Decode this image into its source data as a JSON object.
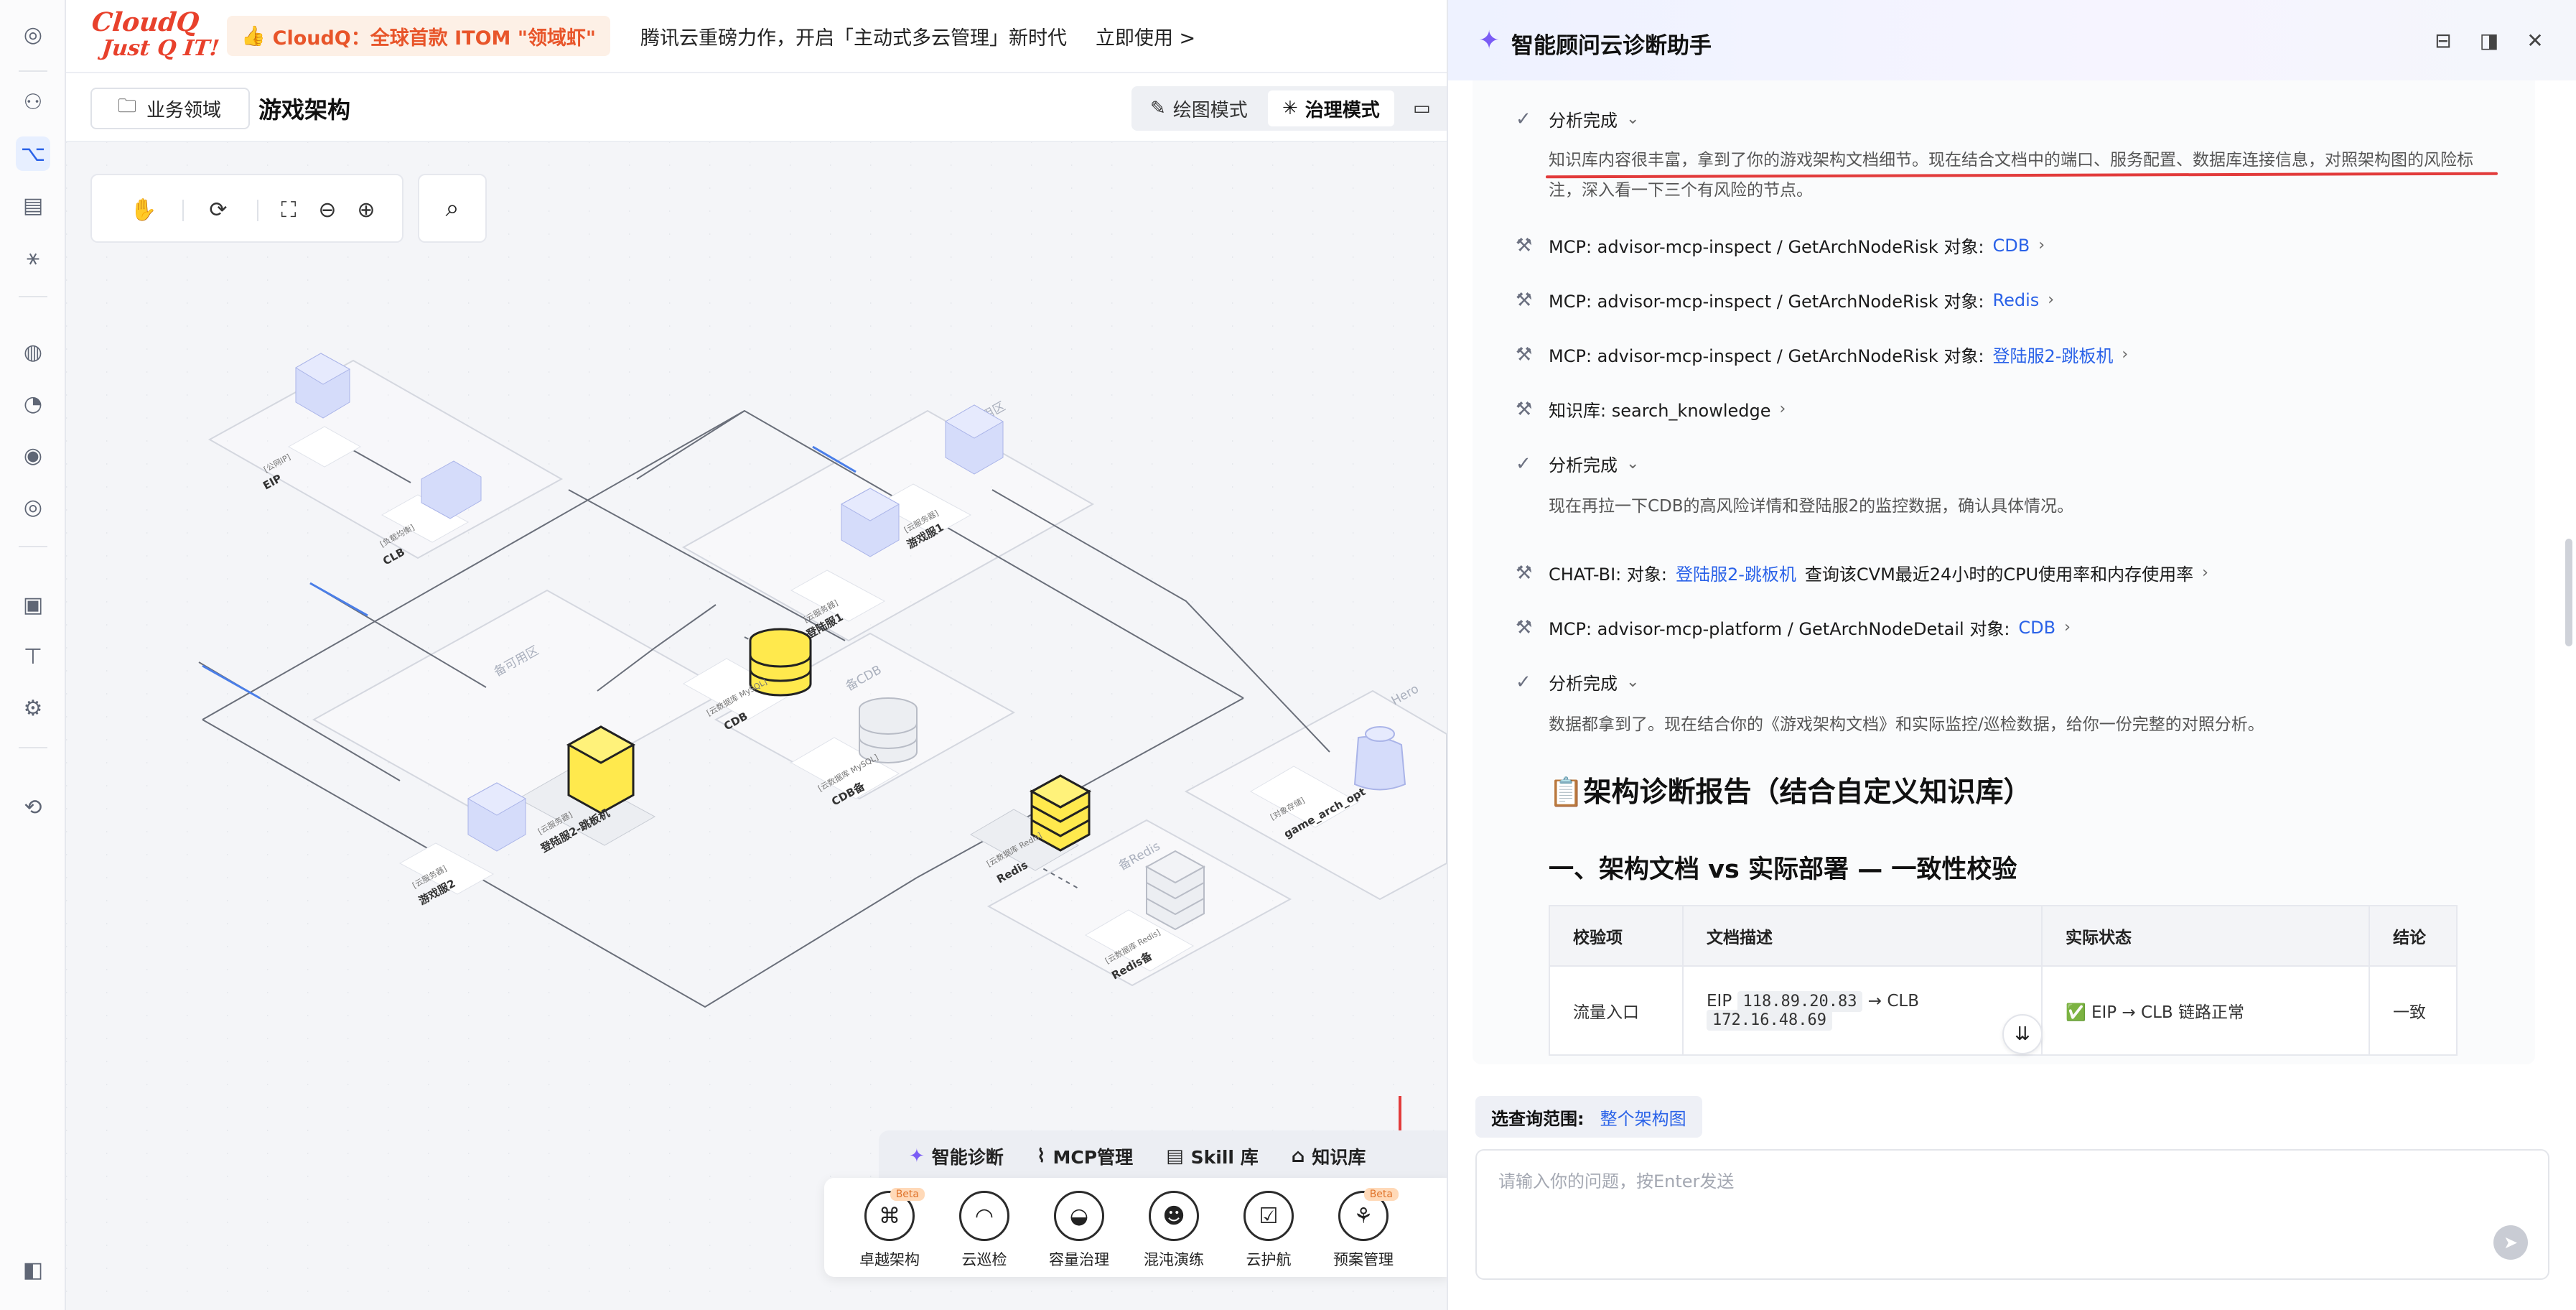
{
  "banner": {
    "logo_line1": "CloudQ",
    "logo_line2": "Just Q IT!",
    "promo_pill": "CloudQ：全球首款 ITOM \"领域虾\"",
    "promo_text": "腾讯云重磅力作，开启「主动式多云管理」新时代",
    "promo_cta": "立即使用 >"
  },
  "workspace": {
    "biz_button": "业务领域",
    "title": "游戏架构",
    "modes": [
      {
        "label": "绘图模式",
        "icon": "pencil-icon"
      },
      {
        "label": "治理模式",
        "icon": "sparkle-icon"
      }
    ]
  },
  "diagram": {
    "zones": [
      "主可用区",
      "备可用区",
      "备CDB",
      "备Redis",
      "Hero"
    ],
    "nodes": [
      {
        "name": "EIP",
        "tag": "[公网IP]"
      },
      {
        "name": "CLB",
        "tag": "[负载均衡]"
      },
      {
        "name": "游戏服1",
        "tag": "[云服务器]"
      },
      {
        "name": "登陆服1",
        "tag": "[云服务器]"
      },
      {
        "name": "CDB",
        "tag": "[云数据库 MySQL]"
      },
      {
        "name": "CDB备",
        "tag": "[云数据库 MySQL]"
      },
      {
        "name": "登陆服2-跳板机",
        "tag": "[云服务器]"
      },
      {
        "name": "游戏服2",
        "tag": "[云服务器]"
      },
      {
        "name": "Redis",
        "tag": "[云数据库 Redis]"
      },
      {
        "name": "Redis备",
        "tag": "[云数据库 Redis]"
      },
      {
        "name": "game_arch_opt",
        "tag": "[对象存储]"
      }
    ]
  },
  "dock": {
    "tabs": [
      {
        "label": "智能诊断",
        "icon": "sparkle-icon"
      },
      {
        "label": "MCP管理",
        "icon": "paperclip-icon"
      },
      {
        "label": "Skill 库",
        "icon": "book-icon"
      },
      {
        "label": "知识库",
        "icon": "inbox-icon"
      }
    ],
    "items": [
      {
        "label": "卓越架构",
        "beta": "Beta",
        "icon": "architecture-icon"
      },
      {
        "label": "云巡检",
        "beta": "",
        "icon": "patrol-icon"
      },
      {
        "label": "容量治理",
        "beta": "",
        "icon": "capacity-icon"
      },
      {
        "label": "混沌演练",
        "beta": "",
        "icon": "chaos-icon"
      },
      {
        "label": "云护航",
        "beta": "",
        "icon": "escort-icon"
      },
      {
        "label": "预案管理",
        "beta": "Beta",
        "icon": "plan-icon"
      }
    ]
  },
  "panel": {
    "title": "智能顾问云诊断助手",
    "steps": {
      "analysis_done": "分析完成",
      "para1": "知识库内容很丰富，拿到了你的游戏架构文档细节。现在结合文档中的端口、服务配置、数据库连接信息，对照架构图的风险标注，深入看一下三个有风险的节点。",
      "mcp_prefix": "MCP: advisor-mcp-inspect / GetArchNodeRisk 对象:",
      "mcp1_target": "CDB",
      "mcp2_target": "Redis",
      "mcp3_target": "登陆服2-跳板机",
      "kb_call": "知识库: search_knowledge",
      "para2": "现在再拉一下CDB的高风险详情和登陆服2的监控数据，确认具体情况。",
      "chatbi_prefix": "CHAT-BI: 对象:",
      "chatbi_target": "登陆服2-跳板机",
      "chatbi_suffix": "查询该CVM最近24小时的CPU使用率和内存使用率",
      "mcp4_prefix": "MCP: advisor-mcp-platform / GetArchNodeDetail 对象:",
      "mcp4_target": "CDB",
      "para3": "数据都拿到了。现在结合你的《游戏架构文档》和实际监控/巡检数据，给你一份完整的对照分析。"
    },
    "report_title": "📋架构诊断报告（结合自定义知识库）",
    "section_title": "一、架构文档 vs 实际部署 — 一致性校验",
    "table": {
      "headers": [
        "校验项",
        "文档描述",
        "实际状态",
        "结论"
      ],
      "rows": [
        {
          "item": "流量入口",
          "doc_prefix": "EIP",
          "doc_ip1": "118.89.20.83",
          "doc_mid": "→ CLB",
          "doc_ip2": "172.16.48.69",
          "status": "✅ EIP → CLB 链路正常",
          "verdict": "一致"
        }
      ]
    },
    "scope_label": "选查询范围:",
    "scope_value": "整个架构图",
    "input_placeholder": "请输入你的问题，按Enter发送"
  }
}
